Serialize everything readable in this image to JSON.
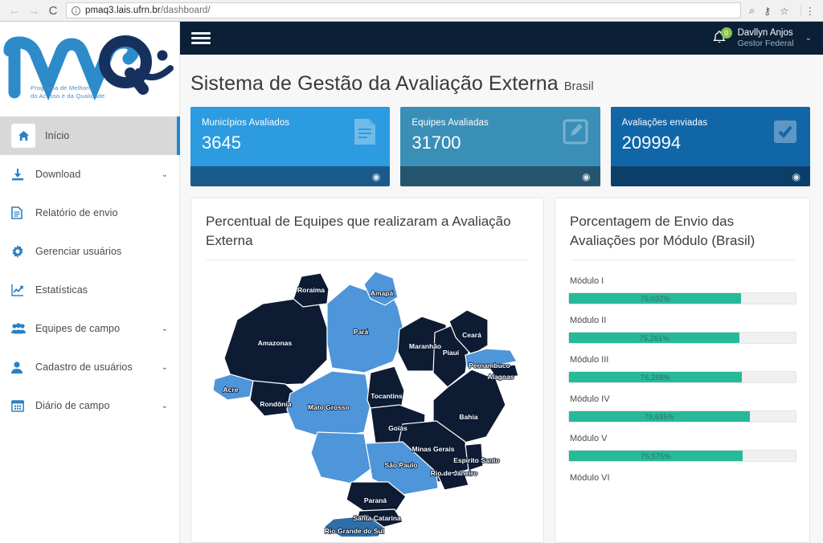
{
  "browser": {
    "back_icon": "←",
    "forward_icon": "→",
    "reload_icon": "C",
    "info_icon": "i",
    "url_host": "pmaq3.lais.ufrn.br",
    "url_path": "/dashboard/",
    "search_icon": "⌕",
    "key_icon": "⚷",
    "star_icon": "☆",
    "menu_icon": "⋮"
  },
  "sidebar": {
    "logo_text": "pmaq",
    "logo_tagline_line1": "Programa de Melhoria",
    "logo_tagline_line2": "do Acesso e da Qualidade",
    "items": [
      {
        "label": "Início",
        "icon": "home-icon",
        "caret": "",
        "active": true
      },
      {
        "label": "Download",
        "icon": "download-icon",
        "caret": "⌄",
        "active": false
      },
      {
        "label": "Relatório de envio",
        "icon": "document-icon",
        "caret": "",
        "active": false
      },
      {
        "label": "Gerenciar usuários",
        "icon": "gear-icon",
        "caret": "",
        "active": false
      },
      {
        "label": "Estatísticas",
        "icon": "chart-line-icon",
        "caret": "",
        "active": false
      },
      {
        "label": "Equipes de campo",
        "icon": "users-icon",
        "caret": "⌄",
        "active": false
      },
      {
        "label": "Cadastro de usuários",
        "icon": "user-icon",
        "caret": "⌄",
        "active": false
      },
      {
        "label": "Diário de campo",
        "icon": "calendar-icon",
        "caret": "⌄",
        "active": false
      }
    ]
  },
  "topbar": {
    "menu_toggle_icon": "hamburger-icon",
    "bell_icon": "🔔",
    "bell_count": "0",
    "user_name": "Davllyn Anjos",
    "user_role": "Gestor Federal",
    "user_caret": "⌄"
  },
  "header": {
    "title": "Sistema de Gestão da Avaliação Externa",
    "scope": "Brasil"
  },
  "cards": [
    {
      "title": "Municípios Avaliados",
      "value": "3645",
      "icon": "file-text-icon",
      "color": "#2c9bdf",
      "foot_color": "#1b5b8c",
      "foot_icon": "◉"
    },
    {
      "title": "Equipes Avaliadas",
      "value": "31700",
      "icon": "edit-square-icon",
      "color": "#3a8fb7",
      "foot_color": "#25556e",
      "foot_icon": "◉"
    },
    {
      "title": "Avaliações enviadas",
      "value": "209994",
      "icon": "check-square-icon",
      "color": "#1166a8",
      "foot_color": "#0b3f6a",
      "foot_icon": "◉"
    }
  ],
  "map_panel": {
    "title": "Percentual de Equipes que realizaram a Avaliação Externa"
  },
  "modules_panel": {
    "title": "Porcentagem de Envio das Avaliações por Módulo (Brasil)",
    "bar_color": "#26b99a",
    "items": [
      {
        "label": "Módulo I",
        "value": 76.032,
        "text": "76,032%"
      },
      {
        "label": "Módulo II",
        "value": 75.261,
        "text": "75,261%"
      },
      {
        "label": "Módulo III",
        "value": 76.268,
        "text": "76,268%"
      },
      {
        "label": "Módulo IV",
        "value": 79.635,
        "text": "79,635%"
      },
      {
        "label": "Módulo V",
        "value": 76.575,
        "text": "76,575%"
      },
      {
        "label": "Módulo VI",
        "value": 0,
        "text": ""
      }
    ]
  },
  "chart_data": {
    "type": "bar",
    "title": "Porcentagem de Envio das Avaliações por Módulo (Brasil)",
    "orientation": "horizontal",
    "categories": [
      "Módulo I",
      "Módulo II",
      "Módulo III",
      "Módulo IV",
      "Módulo V",
      "Módulo VI"
    ],
    "values": [
      76.032,
      75.261,
      76.268,
      79.635,
      76.575,
      null
    ],
    "value_labels": [
      "76,032%",
      "75,261%",
      "76,268%",
      "79,635%",
      "76,575%",
      ""
    ],
    "xlabel": "",
    "ylabel": "",
    "xlim": [
      0,
      100
    ],
    "unit": "%",
    "grid": false,
    "legend": "none",
    "series_color": "#26b99a",
    "note": "Módulo VI label visible but its bar is cut off below the viewport"
  },
  "map_data": {
    "type": "choropleth",
    "title": "Percentual de Equipes que realizaram a Avaliação Externa",
    "region": "Brasil",
    "color_dark": "#0d1b33",
    "color_light": "#4e95d9",
    "color_mid": "#2f6ea8",
    "states": [
      {
        "name": "Roraima",
        "shade": "dark"
      },
      {
        "name": "Amapá",
        "shade": "light"
      },
      {
        "name": "Amazonas",
        "shade": "dark"
      },
      {
        "name": "Pará",
        "shade": "light"
      },
      {
        "name": "Maranhão",
        "shade": "dark"
      },
      {
        "name": "Ceará",
        "shade": "dark"
      },
      {
        "name": "Piauí",
        "shade": "dark"
      },
      {
        "name": "Pernambuco",
        "shade": "light"
      },
      {
        "name": "Alagoas",
        "shade": "dark"
      },
      {
        "name": "Acre",
        "shade": "light"
      },
      {
        "name": "Rondônia",
        "shade": "dark"
      },
      {
        "name": "Tocantins",
        "shade": "dark"
      },
      {
        "name": "Bahia",
        "shade": "dark"
      },
      {
        "name": "Mato Grosso",
        "shade": "light"
      },
      {
        "name": "Goiás",
        "shade": "dark"
      },
      {
        "name": "Minas Gerais",
        "shade": "dark"
      },
      {
        "name": "Espírito Santo",
        "shade": "dark"
      },
      {
        "name": "Rio de Janeiro",
        "shade": "dark"
      },
      {
        "name": "São Paulo",
        "shade": "light"
      },
      {
        "name": "Paraná",
        "shade": "dark"
      },
      {
        "name": "Santa Catarina",
        "shade": "dark"
      },
      {
        "name": "Rio Grande do Sul",
        "shade": "mid"
      }
    ]
  }
}
